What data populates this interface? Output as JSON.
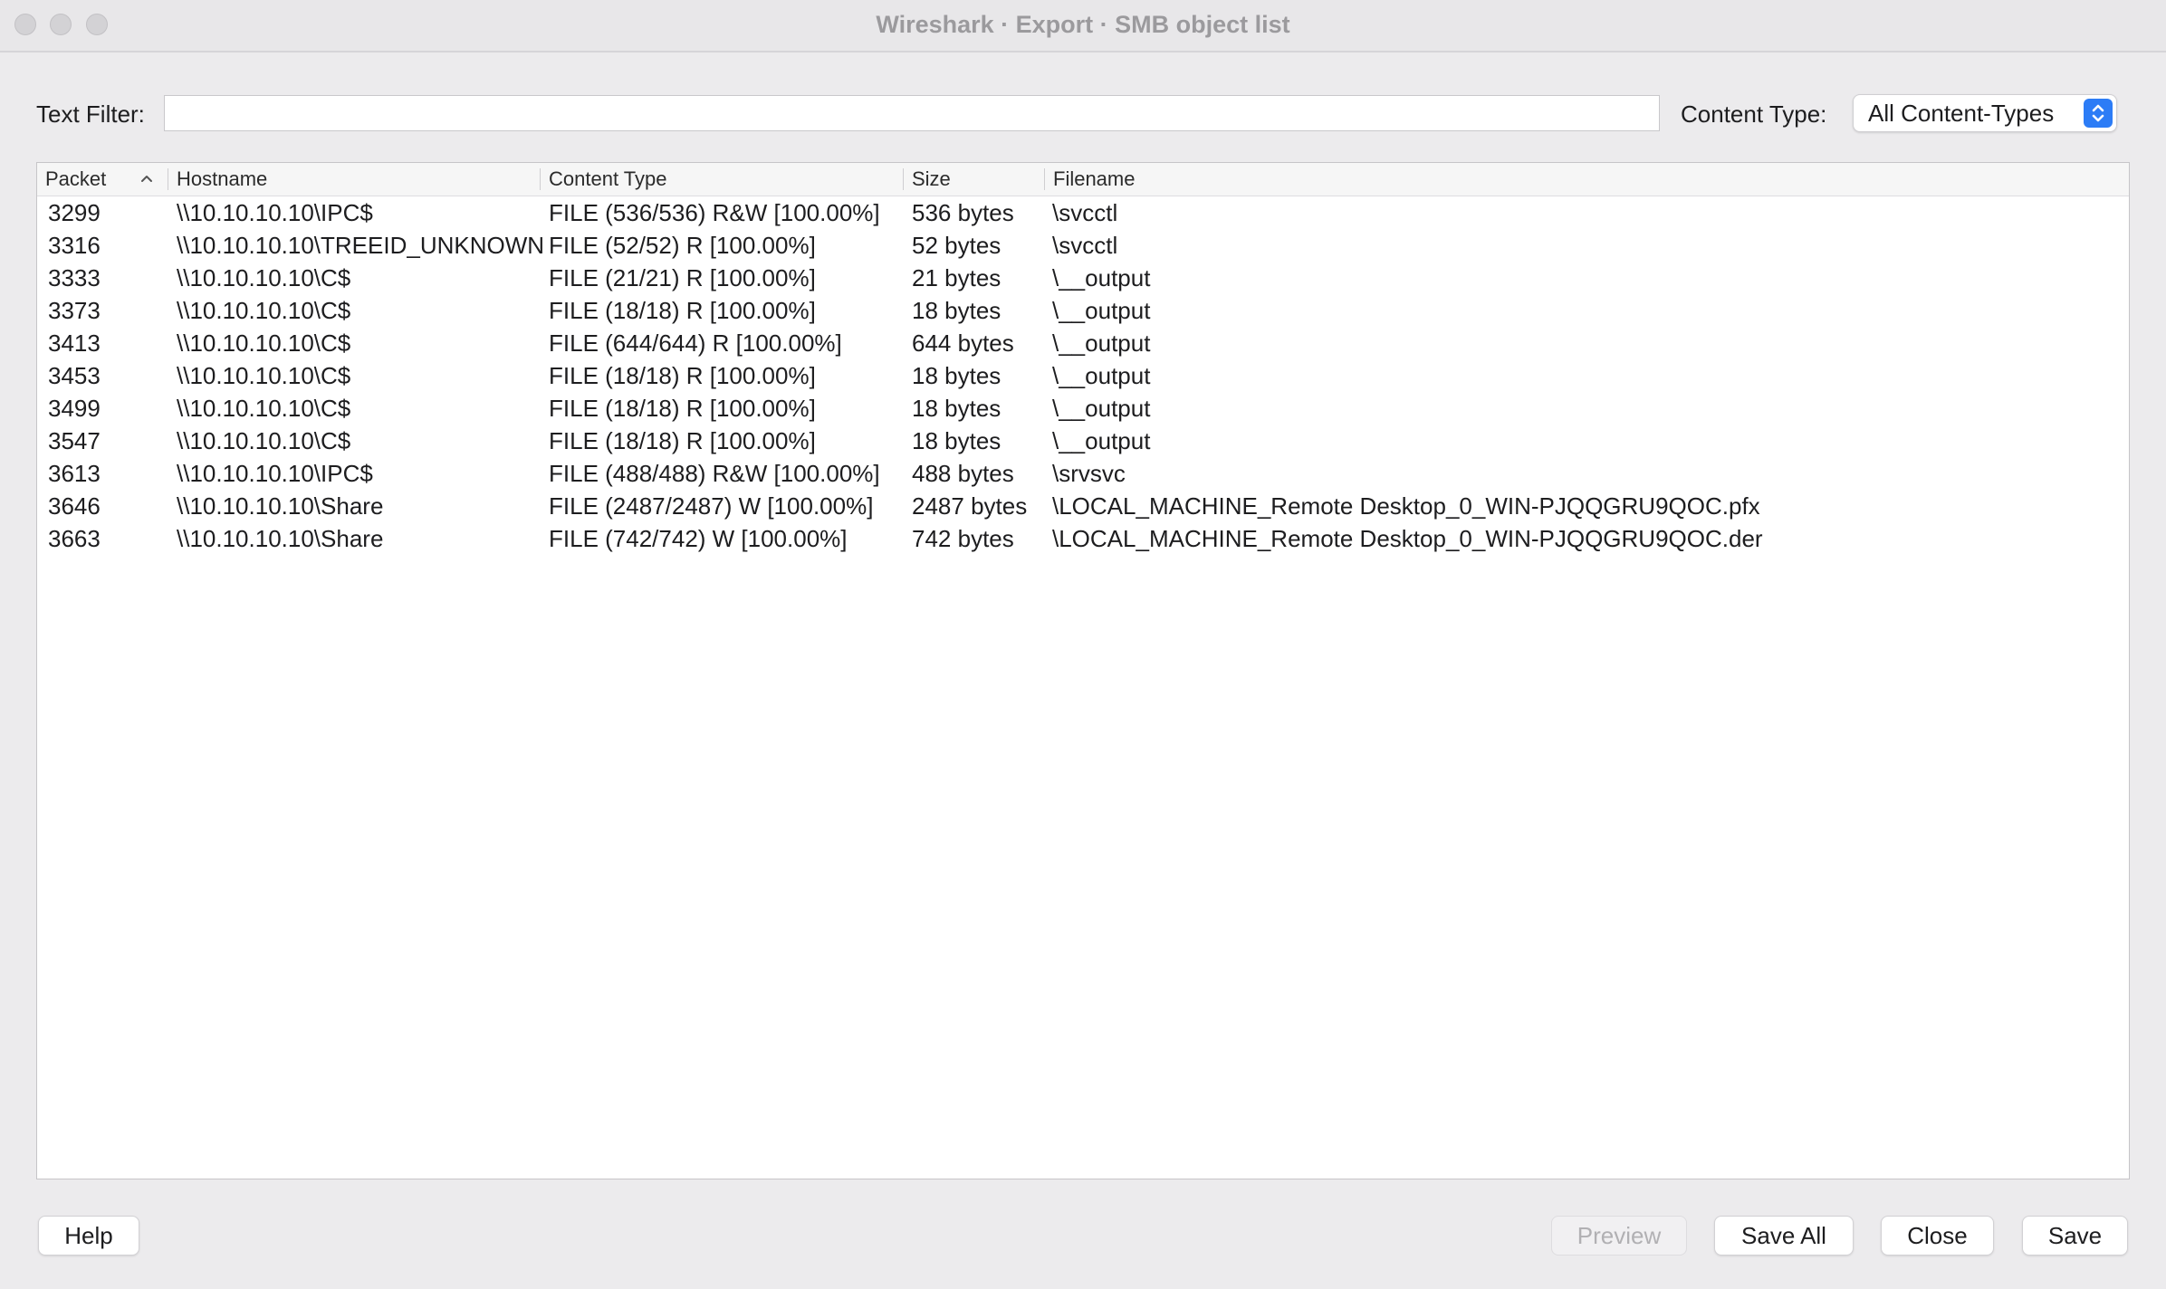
{
  "window": {
    "title": "Wireshark · Export · SMB object list"
  },
  "filter": {
    "label": "Text Filter:",
    "value": "",
    "placeholder": ""
  },
  "content_type": {
    "label": "Content Type:",
    "selected": "All Content-Types"
  },
  "table": {
    "columns": {
      "packet": "Packet",
      "hostname": "Hostname",
      "content_type": "Content Type",
      "size": "Size",
      "filename": "Filename"
    },
    "sort": {
      "column": "packet",
      "direction": "ascending"
    },
    "rows": [
      {
        "packet": "3299",
        "hostname": "\\\\10.10.10.10\\IPC$",
        "content_type": "FILE (536/536) R&W [100.00%]",
        "size": "536 bytes",
        "filename": "\\svcctl"
      },
      {
        "packet": "3316",
        "hostname": "\\\\10.10.10.10\\TREEID_UNKNOWN",
        "content_type": "FILE (52/52) R [100.00%]",
        "size": "52 bytes",
        "filename": "\\svcctl"
      },
      {
        "packet": "3333",
        "hostname": "\\\\10.10.10.10\\C$",
        "content_type": "FILE (21/21) R [100.00%]",
        "size": "21 bytes",
        "filename": "\\__output"
      },
      {
        "packet": "3373",
        "hostname": "\\\\10.10.10.10\\C$",
        "content_type": "FILE (18/18) R [100.00%]",
        "size": "18 bytes",
        "filename": "\\__output"
      },
      {
        "packet": "3413",
        "hostname": "\\\\10.10.10.10\\C$",
        "content_type": "FILE (644/644) R [100.00%]",
        "size": "644 bytes",
        "filename": "\\__output"
      },
      {
        "packet": "3453",
        "hostname": "\\\\10.10.10.10\\C$",
        "content_type": "FILE (18/18) R [100.00%]",
        "size": "18 bytes",
        "filename": "\\__output"
      },
      {
        "packet": "3499",
        "hostname": "\\\\10.10.10.10\\C$",
        "content_type": "FILE (18/18) R [100.00%]",
        "size": "18 bytes",
        "filename": "\\__output"
      },
      {
        "packet": "3547",
        "hostname": "\\\\10.10.10.10\\C$",
        "content_type": "FILE (18/18) R [100.00%]",
        "size": "18 bytes",
        "filename": "\\__output"
      },
      {
        "packet": "3613",
        "hostname": "\\\\10.10.10.10\\IPC$",
        "content_type": "FILE (488/488) R&W [100.00%]",
        "size": "488 bytes",
        "filename": "\\srvsvc"
      },
      {
        "packet": "3646",
        "hostname": "\\\\10.10.10.10\\Share",
        "content_type": "FILE (2487/2487) W [100.00%]",
        "size": "2487 bytes",
        "filename": "\\LOCAL_MACHINE_Remote Desktop_0_WIN-PJQQGRU9QOC.pfx"
      },
      {
        "packet": "3663",
        "hostname": "\\\\10.10.10.10\\Share",
        "content_type": "FILE (742/742) W [100.00%]",
        "size": "742 bytes",
        "filename": "\\LOCAL_MACHINE_Remote Desktop_0_WIN-PJQQGRU9QOC.der"
      }
    ]
  },
  "buttons": {
    "help": "Help",
    "preview": "Preview",
    "save_all": "Save All",
    "close": "Close",
    "save": "Save"
  },
  "icons": {
    "sort": "sort-ascending-icon",
    "select": "up-down-chevron-icon"
  },
  "colors": {
    "accent": "#2c7cf6",
    "background": "#ecebed"
  }
}
